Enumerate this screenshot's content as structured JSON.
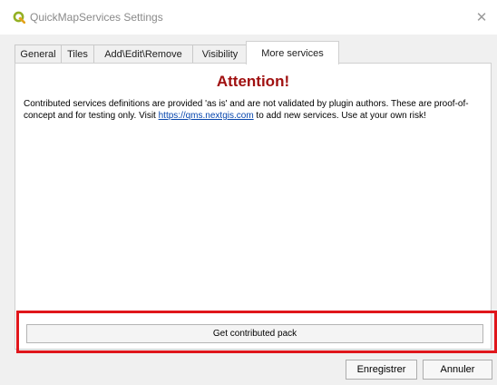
{
  "window": {
    "title": "QuickMapServices Settings",
    "icon": "qgis-logo-icon",
    "close_glyph": "✕"
  },
  "tabs": [
    {
      "label": "General"
    },
    {
      "label": "Tiles"
    },
    {
      "label": "Add\\Edit\\Remove"
    },
    {
      "label": "Visibility"
    },
    {
      "label": "More services",
      "active": true
    }
  ],
  "content": {
    "heading": "Attention!",
    "message_before": "Contributed services definitions are provided 'as is' and are not validated by plugin authors. These are proof-of-concept and for testing only. Visit ",
    "link_text": "https://qms.nextgis.com",
    "message_after": " to add new services. Use at your own risk!",
    "get_pack_label": "Get contributed pack"
  },
  "footer": {
    "save_label": "Enregistrer",
    "cancel_label": "Annuler"
  },
  "colors": {
    "heading": "#a01010",
    "link": "#0645ad",
    "highlight_box": "#e0161b",
    "qgis_green": "#93b023"
  }
}
